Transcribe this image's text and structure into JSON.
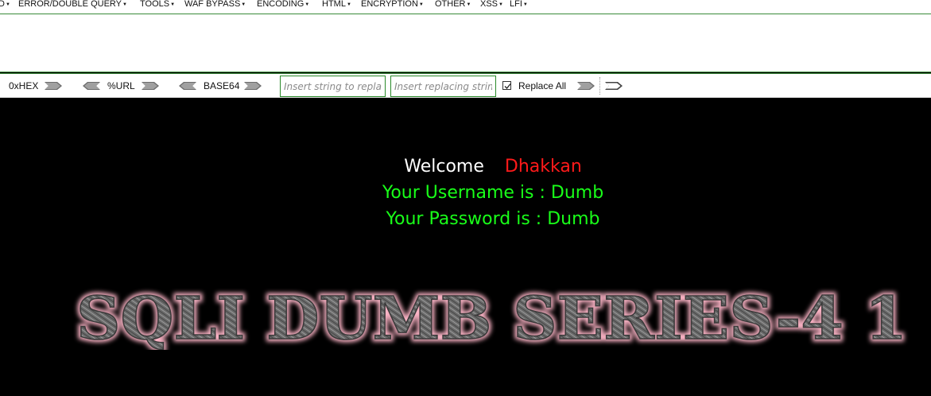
{
  "hackbar": {
    "menu": [
      {
        "label": "D",
        "name": "menu-d"
      },
      {
        "label": "ERROR/DOUBLE QUERY",
        "name": "menu-error-double-query"
      },
      {
        "label": "TOOLS",
        "name": "menu-tools"
      },
      {
        "label": "WAF BYPASS",
        "name": "menu-waf-bypass"
      },
      {
        "label": "ENCODING",
        "name": "menu-encoding"
      },
      {
        "label": "HTML",
        "name": "menu-html"
      },
      {
        "label": "ENCRYPTION",
        "name": "menu-encryption"
      },
      {
        "label": "OTHER",
        "name": "menu-other"
      },
      {
        "label": "XSS",
        "name": "menu-xss"
      },
      {
        "label": "LFI",
        "name": "menu-lfi"
      }
    ],
    "url_value": "",
    "toolbar": {
      "hex_label": "0xHEX",
      "url_label": "%URL",
      "base64_label": "BASE64",
      "find_placeholder": "Insert string to replace",
      "replace_placeholder": "Insert replacing string",
      "replace_all_label": "Replace All",
      "replace_all_checked": true
    }
  },
  "page": {
    "welcome_label": "Welcome",
    "welcome_name": "Dhakkan",
    "username_line": "Your Username is : Dumb",
    "password_line": "Your Password is : Dumb",
    "banner_text": "SQLI DUMB SERIES-4 1",
    "colors": {
      "background": "#000000",
      "welcome": "#ffffff",
      "name": "#ff1a1a",
      "credentials": "#19ff19",
      "banner_glow": "#ffb6c8"
    }
  }
}
